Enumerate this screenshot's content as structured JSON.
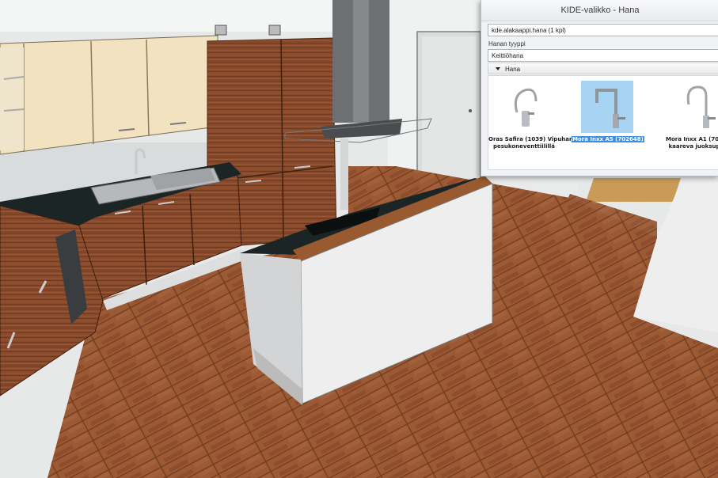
{
  "window": {
    "title": "KIDE-valikko - Hana"
  },
  "product_field": {
    "value": "kde.alakaappi.hana (1 kpl)"
  },
  "type_label": "Hanan tyyppi",
  "type_select": {
    "value": "Keittiöhana"
  },
  "section": {
    "label": "Hana",
    "icon": "triangle-down-icon"
  },
  "faucets": [
    {
      "line1": "Oras Safira (1039) Vipuhana",
      "line2": "pesukoneventtiilillä",
      "selected": false
    },
    {
      "line1": "Mora Inxx A5 (702648)",
      "line2": "",
      "selected": true
    },
    {
      "line1": "Mora Inxx A1 (702",
      "line2": "kaareva juoksup",
      "selected": false
    }
  ],
  "colors": {
    "floor": "#9a5a35",
    "cabinet_wood": "#8a4a2a",
    "cream_doors": "#f3e2c0",
    "countertop": "#1a2424",
    "wall": "#e6e8e8",
    "selection": "#3a8ee6"
  }
}
